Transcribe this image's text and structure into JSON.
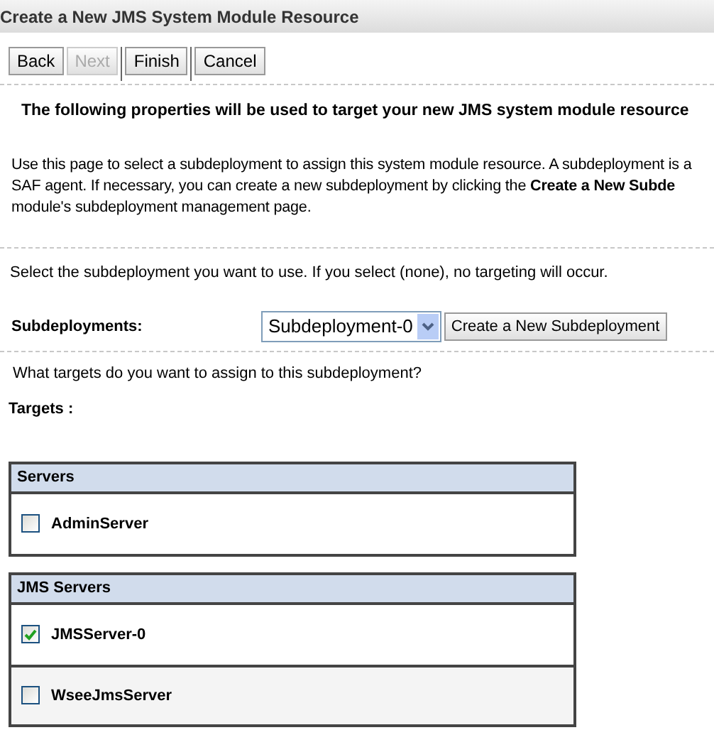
{
  "window": {
    "title": "Create a New JMS System Module Resource"
  },
  "buttons": [
    {
      "label": "Back",
      "disabled": false
    },
    {
      "label": "Next",
      "disabled": true
    },
    {
      "label": "Finish",
      "disabled": false
    },
    {
      "label": "Cancel",
      "disabled": false
    }
  ],
  "heading": "The following properties will be used to target your new JMS system module resource",
  "description_lines": [
    "Use this page to select a subdeployment to assign this system module resource. A subdeployment is a",
    "SAF agent. If necessary, you can create a new subdeployment by clicking the **Create a New Subde**",
    "module's subdeployment management page."
  ],
  "select_hint": "Select the subdeployment you want to use. If you select (none), no targeting will occur.",
  "subdeployments": {
    "label": "Subdeployments:",
    "value": "Subdeployment-0",
    "create_button": "Create a New Subdeployment"
  },
  "targets_question": "What targets do you want to assign to this subdeployment?",
  "targets_label": "Targets :",
  "target_groups": [
    {
      "title": "Servers",
      "items": [
        {
          "label": "AdminServer",
          "checked": false
        }
      ]
    },
    {
      "title": "JMS Servers",
      "items": [
        {
          "label": "JMSServer-0",
          "checked": true
        },
        {
          "label": "WseeJmsServer",
          "checked": false
        }
      ]
    }
  ]
}
